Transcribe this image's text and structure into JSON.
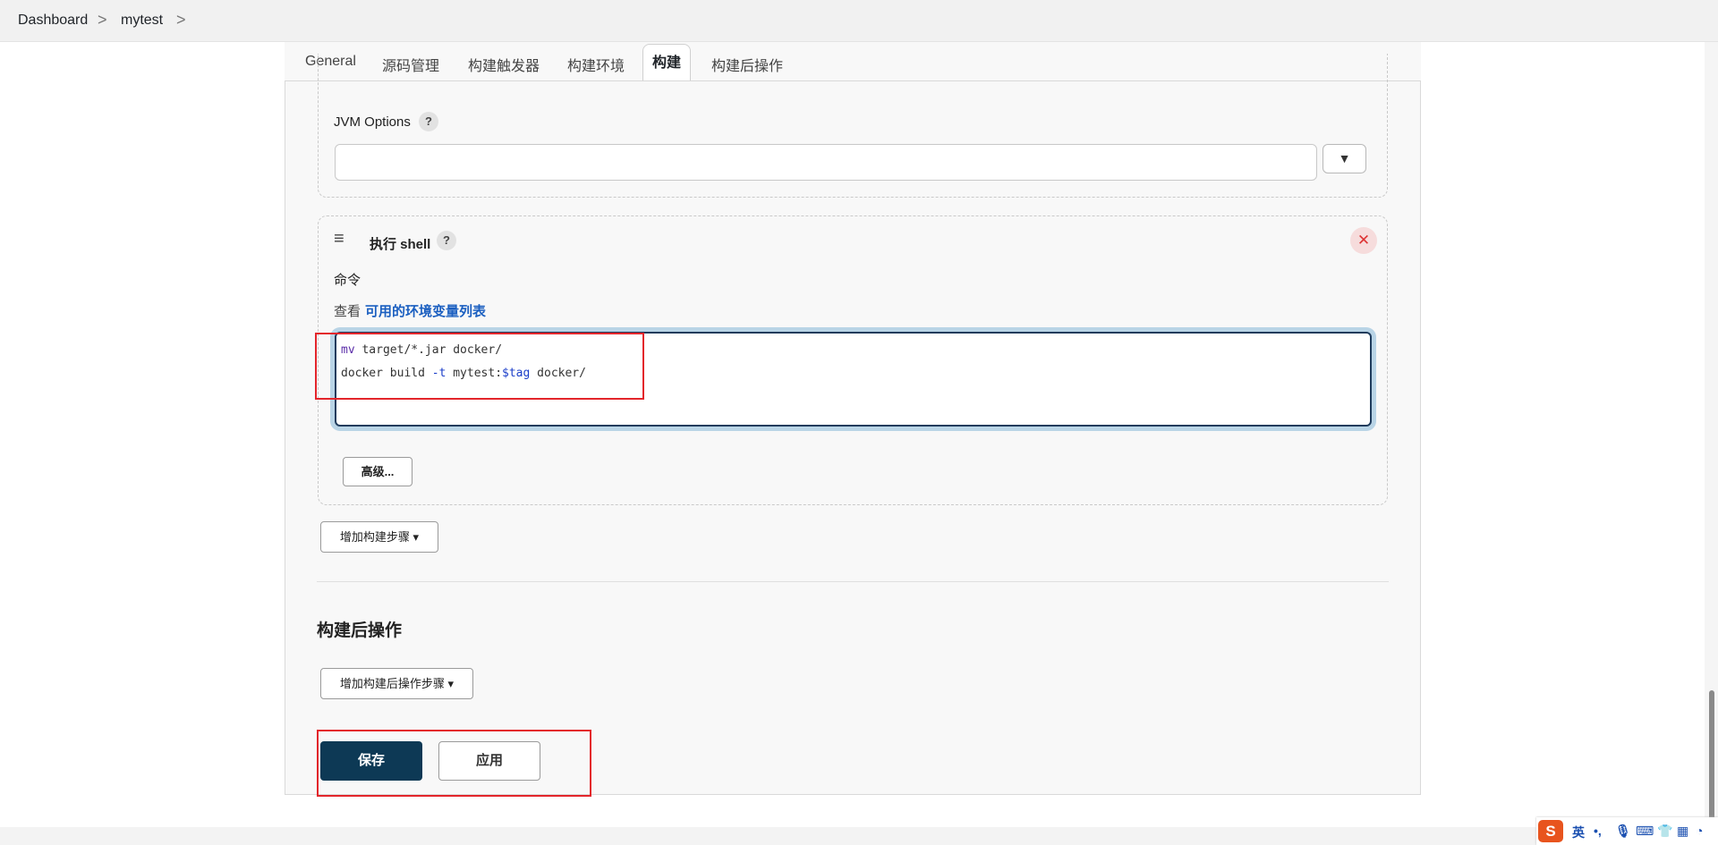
{
  "breadcrumb": {
    "items": [
      "Dashboard",
      "mytest"
    ],
    "separator": ">"
  },
  "tabs": [
    "General",
    "源码管理",
    "构建触发器",
    "构建环境",
    "构建",
    "构建后操作"
  ],
  "active_tab": "构建",
  "jvm_options": {
    "label": "JVM Options",
    "help": "?",
    "value": "",
    "dropdown_glyph": "▼"
  },
  "shell_step": {
    "drag_glyph": "≡",
    "title": "执行 shell",
    "help": "?",
    "close_glyph": "✕",
    "command_label": "命令",
    "env_prefix": "查看",
    "env_link": "可用的环境变量列表",
    "code": {
      "line1": {
        "cmd": "mv",
        "rest": " target/*.jar docker/"
      },
      "line2": {
        "pre": "docker build ",
        "flag": "-t",
        "mid": " mytest:",
        "var": "$tag",
        "post": " docker/"
      }
    },
    "advanced_button": "高级..."
  },
  "add_build_step": "增加构建步骤",
  "post_build": {
    "heading": "构建后操作",
    "add_step": "增加构建后操作步骤"
  },
  "actions": {
    "save": "保存",
    "apply": "应用"
  },
  "ime": {
    "logo": "S",
    "lang": "英",
    "punct": "•,"
  },
  "colors": {
    "save_bg": "#0d3955",
    "highlight_red": "#e3252b",
    "link": "#1b5fc0",
    "editor_focus": "#b9d4e6"
  }
}
